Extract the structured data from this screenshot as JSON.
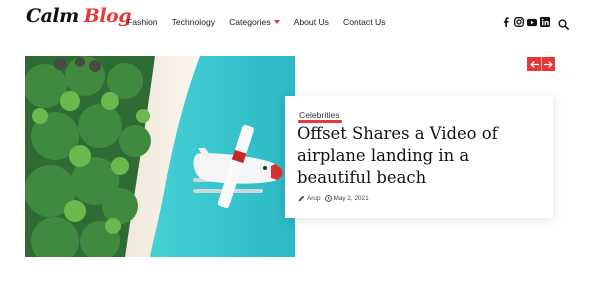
{
  "brand": {
    "word1": "Calm",
    "word2": "Blog",
    "accent": "#e23a3a"
  },
  "nav": {
    "items": [
      {
        "label": "Fashion"
      },
      {
        "label": "Technology"
      },
      {
        "label": "Categories"
      },
      {
        "label": "About Us"
      },
      {
        "label": "Contact Us"
      }
    ]
  },
  "social": {
    "icons": [
      "facebook-icon",
      "instagram-icon",
      "youtube-icon",
      "linkedin-icon"
    ]
  },
  "hero": {
    "image": "aerial-beach-seaplane",
    "category": "Celebrities",
    "title": "Offset Shares a Video of airplane landing in a beautiful beach",
    "author": "Arup",
    "date": "May 2, 2021"
  },
  "slider": {
    "prev_icon": "arrow-left-icon",
    "next_icon": "arrow-right-icon"
  }
}
